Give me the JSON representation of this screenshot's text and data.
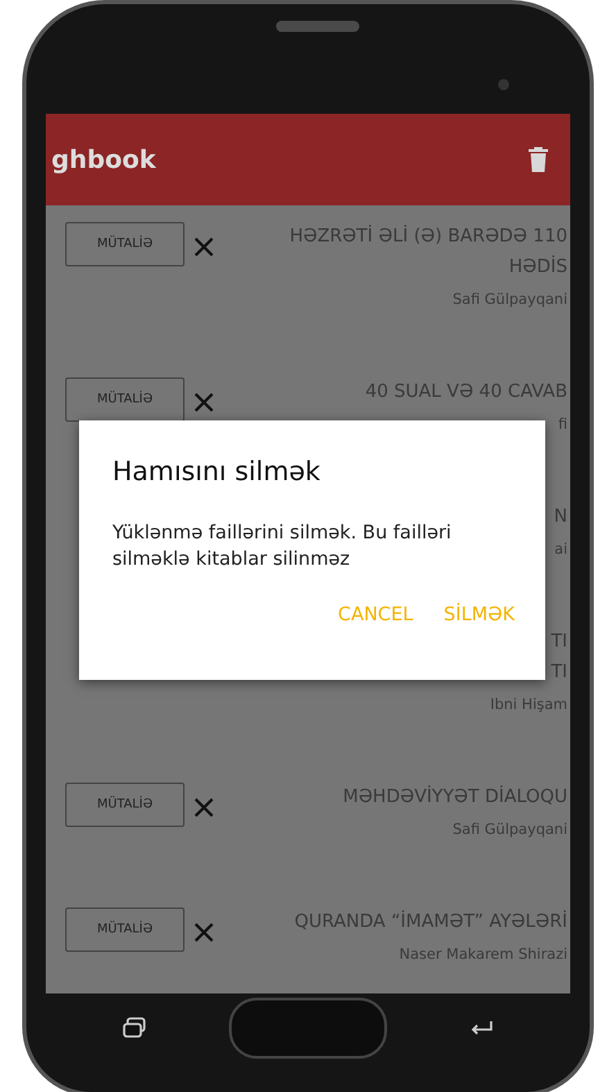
{
  "app_bar": {
    "title": "ghbook"
  },
  "books": [
    {
      "button": "MÜTALİƏ",
      "title": "HƏZRƏTİ ƏLİ (Ə) BARƏDƏ 110 HƏDİS",
      "author": "Safi Gülpayqani"
    },
    {
      "button": "MÜTALİƏ",
      "title": "40 SUAL VƏ 40 CAVAB",
      "author": "fi"
    },
    {
      "title": "N",
      "author": "ai"
    },
    {
      "title": "TI\nTI",
      "author": "Ibni Hişam"
    },
    {
      "button": "MÜTALİƏ",
      "title": "MƏHDƏVİYYƏT DİALOQU",
      "author": "Safi Gülpayqani"
    },
    {
      "button": "MÜTALİƏ",
      "title": "QURANDA “İMAMƏT” AYƏLƏRİ",
      "author": "Naser Makarem Shirazi"
    }
  ],
  "dialog": {
    "title": "Hamısını silmək",
    "message": "Yüklənmə faillərini silmək. Bu failləri silməklə kitablar silinməz",
    "buttons": [
      "CANCEL",
      "SİLMƏK"
    ]
  }
}
